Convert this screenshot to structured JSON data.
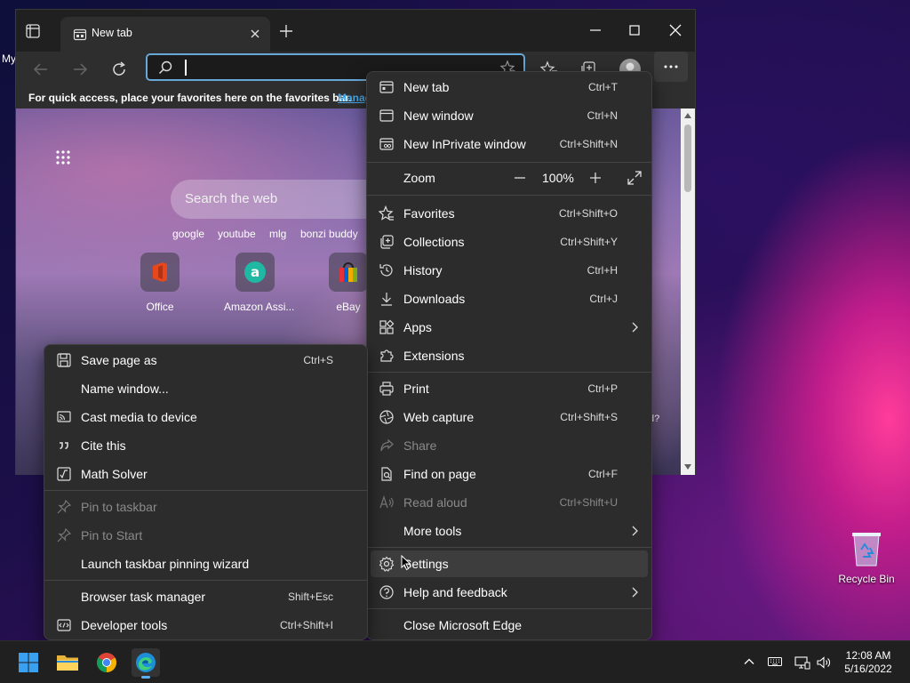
{
  "desktop": {
    "partial_label": "My",
    "recycle_bin": "Recycle Bin"
  },
  "browser": {
    "tab_title": "New tab",
    "favbar_text": "For quick access, place your favorites here on the favorites bar.",
    "favbar_link": "Manage",
    "newtab": {
      "search_placeholder": "Search the web",
      "quick_links": [
        "google",
        "youtube",
        "mlg",
        "bonzi buddy"
      ],
      "tiles": [
        "Office",
        "Amazon Assi...",
        "eBay"
      ],
      "strip_text": "d?"
    }
  },
  "main_menu": {
    "new_tab": {
      "label": "New tab",
      "shortcut": "Ctrl+T"
    },
    "new_window": {
      "label": "New window",
      "shortcut": "Ctrl+N"
    },
    "new_inprivate": {
      "label": "New InPrivate window",
      "shortcut": "Ctrl+Shift+N"
    },
    "zoom": {
      "label": "Zoom",
      "value": "100%"
    },
    "favorites": {
      "label": "Favorites",
      "shortcut": "Ctrl+Shift+O"
    },
    "collections": {
      "label": "Collections",
      "shortcut": "Ctrl+Shift+Y"
    },
    "history": {
      "label": "History",
      "shortcut": "Ctrl+H"
    },
    "downloads": {
      "label": "Downloads",
      "shortcut": "Ctrl+J"
    },
    "apps": {
      "label": "Apps"
    },
    "extensions": {
      "label": "Extensions"
    },
    "print": {
      "label": "Print",
      "shortcut": "Ctrl+P"
    },
    "web_capture": {
      "label": "Web capture",
      "shortcut": "Ctrl+Shift+S"
    },
    "share": {
      "label": "Share"
    },
    "find_on_page": {
      "label": "Find on page",
      "shortcut": "Ctrl+F"
    },
    "read_aloud": {
      "label": "Read aloud",
      "shortcut": "Ctrl+Shift+U"
    },
    "more_tools": {
      "label": "More tools"
    },
    "settings": {
      "label": "Settings"
    },
    "help": {
      "label": "Help and feedback"
    },
    "close_edge": {
      "label": "Close Microsoft Edge"
    }
  },
  "more_tools_menu": {
    "save_page": {
      "label": "Save page as",
      "shortcut": "Ctrl+S"
    },
    "name_window": {
      "label": "Name window..."
    },
    "cast_media": {
      "label": "Cast media to device"
    },
    "cite_this": {
      "label": "Cite this"
    },
    "math_solver": {
      "label": "Math Solver"
    },
    "pin_taskbar": {
      "label": "Pin to taskbar"
    },
    "pin_start": {
      "label": "Pin to Start"
    },
    "launch_wizard": {
      "label": "Launch taskbar pinning wizard"
    },
    "task_manager": {
      "label": "Browser task manager",
      "shortcut": "Shift+Esc"
    },
    "dev_tools": {
      "label": "Developer tools",
      "shortcut": "Ctrl+Shift+I"
    }
  },
  "taskbar": {
    "time": "12:08 AM",
    "date": "5/16/2022"
  },
  "colors": {
    "menu_bg": "#2c2c2c",
    "accent": "#60b0f0",
    "address_border": "#68a8d8"
  }
}
